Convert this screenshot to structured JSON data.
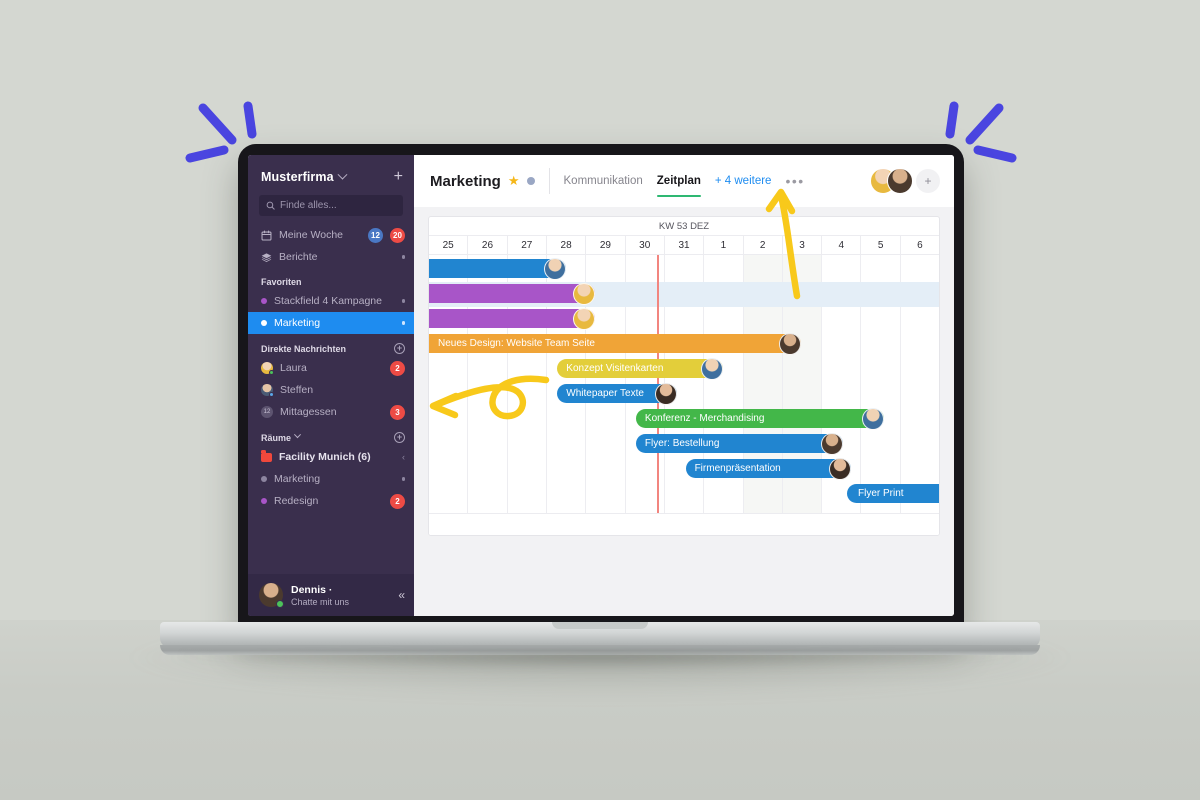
{
  "workspace": {
    "org_name": "Musterfirma",
    "org_caret_icon": "chevron-down-icon",
    "add_icon": "plus-icon",
    "search_placeholder": "Finde alles...",
    "search_icon": "search-icon",
    "nav": [
      {
        "label": "Meine Woche",
        "icon": "calendar-icon",
        "badges": [
          {
            "text": "12",
            "color": "#4a78c4"
          },
          {
            "text": "20",
            "color": "#ed4b45"
          }
        ]
      },
      {
        "label": "Berichte",
        "icon": "layers-icon",
        "caret": "·"
      }
    ],
    "favorites_heading": "Favoriten",
    "favorites": [
      {
        "label": "Stackfield 4 Kampagne",
        "dot_color": "#a855c8",
        "trailing": "dot",
        "selected": false
      },
      {
        "label": "Marketing",
        "dot_color": "#ffffff",
        "trailing": "dot",
        "selected": true
      }
    ],
    "dm_heading": "Direkte Nachrichten",
    "dm_add_icon": "plus-circle-icon",
    "direct_messages": [
      {
        "label": "Laura",
        "avatar": "woman-yellow",
        "status": "#4cc35a",
        "badge": "2"
      },
      {
        "label": "Steffen",
        "avatar": "man-blue",
        "status": "#5aa7e8",
        "badge": ""
      },
      {
        "label": "Mittagessen",
        "avatar": "group-12",
        "status": "",
        "badge": "3"
      }
    ],
    "rooms_heading": "Räume",
    "rooms_caret_icon": "chevron-down-icon",
    "rooms_add_icon": "plus-circle-icon",
    "rooms": [
      {
        "label": "Facility Munich (6)",
        "icon": "folder-icon",
        "trailing": "chevron-left-icon",
        "badge": ""
      },
      {
        "label": "Marketing",
        "dot_color": "#8d85a0",
        "trailing": "dot",
        "badge": ""
      },
      {
        "label": "Redesign",
        "dot_color": "#a855c8",
        "trailing": "badge",
        "badge": "2"
      }
    ],
    "user": {
      "name": "Dennis ·",
      "subtitle": "Chatte mit uns",
      "avatar": "man-dark",
      "status_color": "#4cc35a",
      "collapse_icon": "chevron-double-left-icon"
    }
  },
  "header": {
    "project_title": "Marketing",
    "star_icon": "star-icon",
    "project_dot_color": "#9aa7c4",
    "tabs": [
      {
        "label": "Kommunikation",
        "active": false,
        "kind": "normal"
      },
      {
        "label": "Zeitplan",
        "active": true,
        "kind": "normal"
      },
      {
        "label": "+ 4 weitere",
        "active": false,
        "kind": "more"
      }
    ],
    "overflow_icon": "ellipsis-icon",
    "members": [
      {
        "avatar": "woman-yellow"
      },
      {
        "avatar": "man-dark"
      }
    ],
    "add_member_icon": "plus-icon"
  },
  "timeline": {
    "week_label": "KW 53 DEZ",
    "days": [
      "25",
      "26",
      "27",
      "28",
      "29",
      "30",
      "31",
      "1",
      "2",
      "3",
      "4",
      "5",
      "6"
    ],
    "weekend_columns": [
      8,
      9
    ],
    "highlight_band_row": 1,
    "today_column": 5,
    "today_line_color": "#f2857f",
    "tasks": [
      {
        "label": "",
        "color": "#2185d0",
        "start": 0,
        "span": 3.3,
        "avatar": "man-blue",
        "row": 0
      },
      {
        "label": "",
        "color": "#a855c8",
        "start": 0,
        "span": 4.0,
        "avatar": "woman-yellow",
        "row": 1
      },
      {
        "label": "",
        "color": "#a855c8",
        "start": 0,
        "span": 4.0,
        "avatar": "woman-yellow",
        "row": 2
      },
      {
        "label": "Neues Design: Website Team Seite",
        "color": "#f0a437",
        "start": 0,
        "span": 9.0,
        "avatar": "man-dark",
        "row": 3
      },
      {
        "label": "Konzept Visitenkarten",
        "color": "#e3ce3a",
        "start": 3.1,
        "span": 4.0,
        "avatar": "man-blue",
        "row": 4
      },
      {
        "label": "Whitepaper Texte",
        "color": "#2185d0",
        "start": 3.1,
        "span": 2.9,
        "avatar": "woman-dark",
        "row": 5
      },
      {
        "label": "Konferenz - Merchandising",
        "color": "#43b749",
        "start": 5.0,
        "span": 6.0,
        "avatar": "man-blue",
        "row": 6
      },
      {
        "label": "Flyer: Bestellung",
        "color": "#2185d0",
        "start": 5.0,
        "span": 5.0,
        "avatar": "man-dark",
        "row": 7
      },
      {
        "label": "Firmenpräsentation",
        "color": "#2185d0",
        "start": 6.2,
        "span": 4.0,
        "avatar": "woman-dark",
        "row": 8
      },
      {
        "label": "Flyer Print",
        "color": "#2185d0",
        "start": 10.1,
        "span": 3.4,
        "avatar": "",
        "row": 9
      }
    ]
  },
  "annotations": [
    {
      "name": "arrow-to-overflow-menu",
      "color": "#f8c91b"
    },
    {
      "name": "arrow-to-timeline-left",
      "color": "#f8c91b"
    }
  ],
  "decor": {
    "sparkle_color": "#4a45e0",
    "background_color": "#d4d7d1"
  }
}
